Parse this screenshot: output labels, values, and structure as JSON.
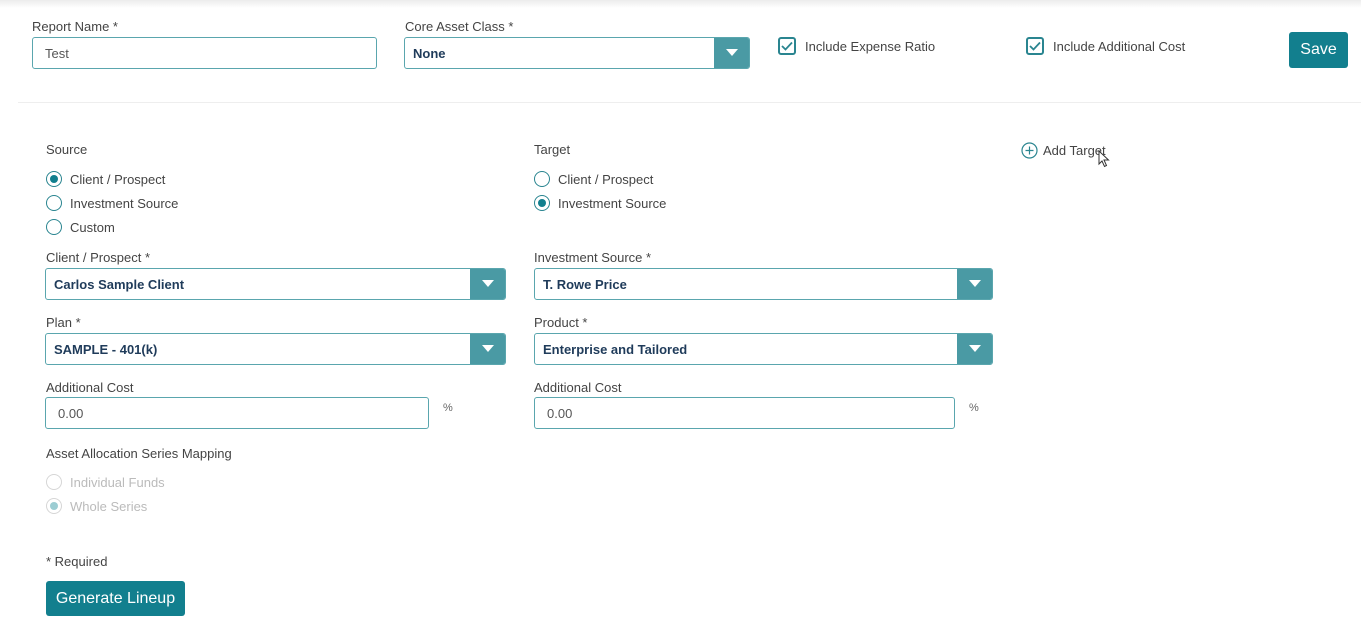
{
  "header": {
    "report_name_label": "Report Name *",
    "report_name_value": "Test",
    "core_asset_class_label": "Core Asset Class *",
    "core_asset_class_value": "None",
    "include_expense_ratio_label": "Include Expense Ratio",
    "include_expense_ratio_checked": true,
    "include_additional_cost_label": "Include Additional Cost",
    "include_additional_cost_checked": true,
    "save_label": "Save"
  },
  "source": {
    "title": "Source",
    "options": [
      {
        "label": "Client / Prospect",
        "selected": true
      },
      {
        "label": "Investment Source",
        "selected": false
      },
      {
        "label": "Custom",
        "selected": false
      }
    ],
    "client_label": "Client / Prospect *",
    "client_value": "Carlos Sample Client",
    "plan_label": "Plan *",
    "plan_value": "SAMPLE - 401(k)",
    "additional_cost_label": "Additional Cost",
    "additional_cost_value": "0.00",
    "pct_symbol": "%"
  },
  "target": {
    "title": "Target",
    "options": [
      {
        "label": "Client / Prospect",
        "selected": false
      },
      {
        "label": "Investment Source",
        "selected": true
      }
    ],
    "investment_source_label": "Investment Source *",
    "investment_source_value": "T. Rowe Price",
    "product_label": "Product *",
    "product_value": "Enterprise and Tailored",
    "additional_cost_label": "Additional Cost",
    "additional_cost_value": "0.00",
    "pct_symbol": "%",
    "add_target_label": "Add Target"
  },
  "mapping": {
    "title": "Asset Allocation Series Mapping",
    "options": [
      {
        "label": "Individual Funds",
        "selected": false
      },
      {
        "label": "Whole Series",
        "selected": true
      }
    ]
  },
  "footer": {
    "required_note": "* Required",
    "generate_label": "Generate Lineup"
  },
  "colors": {
    "accent": "#127f8e",
    "dropdown_arrow_bg": "#4a9aa4",
    "input_border": "#5aa6ae",
    "select_text": "#1f3b5a"
  },
  "icons": {
    "dropdown": "chevron-down-icon",
    "check": "check-icon",
    "add": "plus-circle-icon",
    "cursor": "mouse-pointer-icon"
  }
}
